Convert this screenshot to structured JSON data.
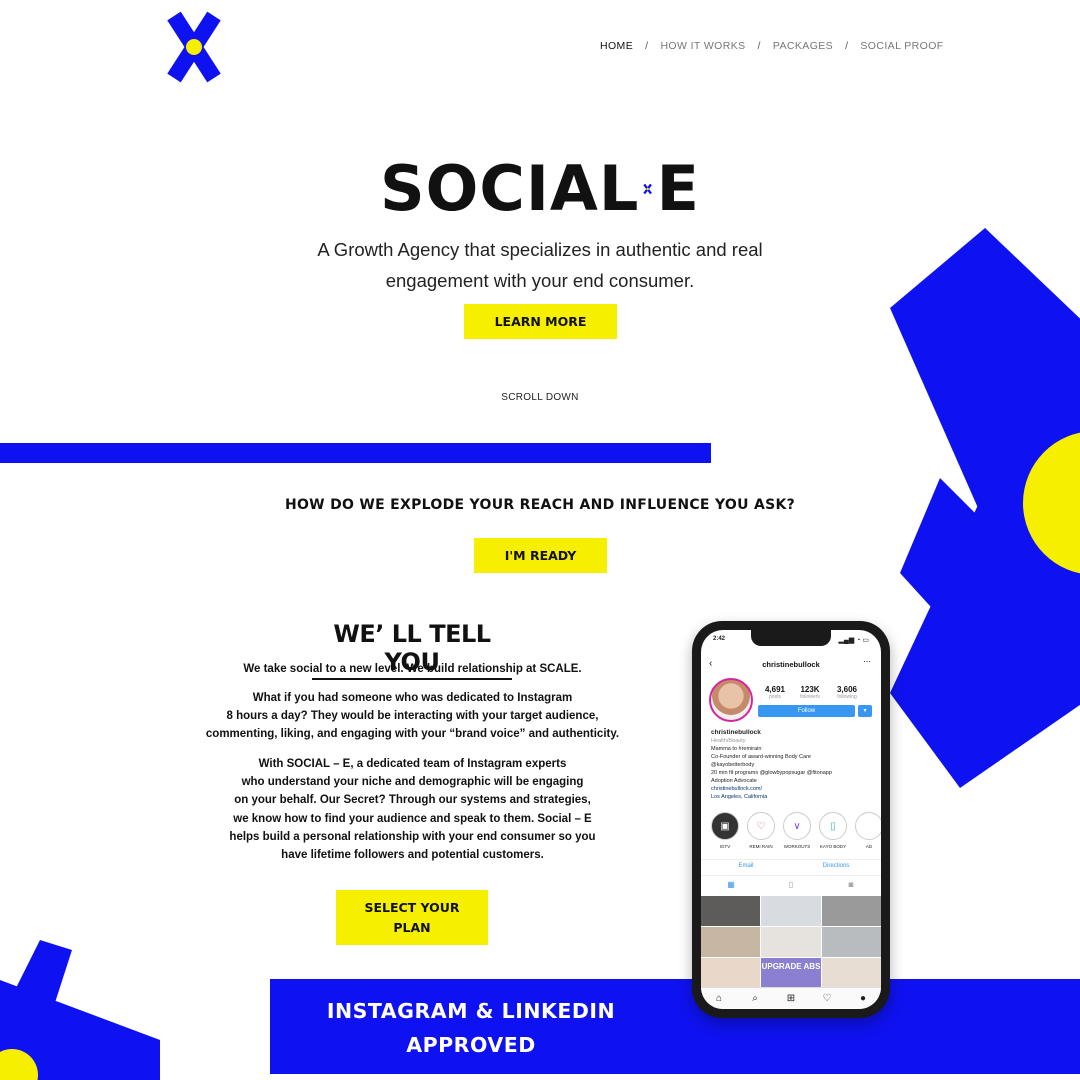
{
  "nav": {
    "items": [
      {
        "label": "HOME",
        "active": true
      },
      {
        "label": "HOW IT WORKS",
        "active": false
      },
      {
        "label": "PACKAGES",
        "active": false
      },
      {
        "label": "SOCIAL PROOF",
        "active": false
      }
    ],
    "separator": "/"
  },
  "hero": {
    "brand_left": "SOCIAL",
    "brand_right": "E",
    "tagline_line1": "A Growth Agency that specializes in authentic and real",
    "tagline_line2": "engagement with your end consumer.",
    "cta_label": "LEARN MORE",
    "scroll_label": "SCROLL DOWN"
  },
  "section2": {
    "question": "HOW DO WE EXPLODE YOUR REACH AND INFLUENCE YOU ASK?",
    "cta_label": "I'M READY"
  },
  "section3": {
    "heading": "WE’ LL TELL YOU",
    "p1": "We take social to a new level. We build relationship at SCALE.",
    "p2_lines": [
      "What if you had someone who was dedicated to Instagram",
      "8 hours a day? They would be interacting with your target audience,",
      "commenting, liking, and engaging with your “brand voice” and authenticity."
    ],
    "p3_lines": [
      "With SOCIAL – E, a dedicated team of Instagram experts",
      "who understand your niche and demographic will be engaging",
      "on your behalf. Our Secret? Through our systems and strategies,",
      "we know how to find your audience and speak to them. Social – E",
      "helps build a personal relationship with your end consumer so you",
      "have lifetime followers and potential customers."
    ],
    "cta_line1": "SELECT YOUR",
    "cta_line2": "PLAN"
  },
  "banner": {
    "line1": "INSTAGRAM & LINKEDIN",
    "line2": "APPROVED"
  },
  "phone": {
    "time": "2:42",
    "username": "christinebullock",
    "stats": [
      {
        "value": "4,691",
        "label": "posts"
      },
      {
        "value": "123K",
        "label": "followers"
      },
      {
        "value": "3,606",
        "label": "following"
      }
    ],
    "follow_label": "Follow",
    "bio_name": "christinebullock",
    "bio_category": "Health/Beauty",
    "bio_lines": [
      "Mamma to #remirain",
      "Co-Founder of award-winning Body Care",
      "@kayobetterbody",
      "20 min fit programs @glowbypopsugar @fitonapp",
      "Adoption Advocate"
    ],
    "bio_link": "christinebullock.com/",
    "bio_location": "Los Angeles, California",
    "highlights": [
      "IGTV",
      "REMI RAIN",
      "WORKOUTS",
      "KAYO BODY",
      "AD"
    ],
    "email_label": "Email",
    "directions_label": "Directions",
    "grid_text": "UPGRADE ABS"
  },
  "colors": {
    "brand_blue": "#0f12f0",
    "brand_yellow": "#f7ef00",
    "text_dark": "#111111"
  }
}
